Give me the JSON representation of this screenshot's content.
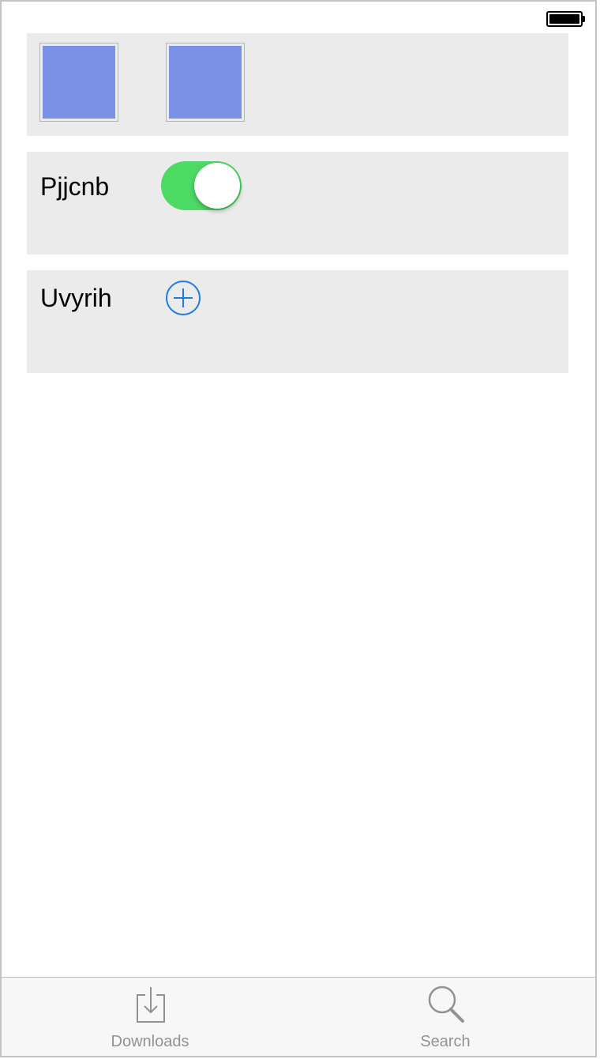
{
  "status_bar": {
    "battery_icon": "battery-full-icon"
  },
  "image_row": {
    "thumbnails": [
      {
        "icon": "image-placeholder",
        "color": "#7a91e6"
      },
      {
        "icon": "image-placeholder",
        "color": "#7a91e6"
      }
    ]
  },
  "toggle_row": {
    "label": "Pjjcnb",
    "on": true,
    "on_color": "#4cd964"
  },
  "add_row": {
    "label": "Uvyrih",
    "icon": "plus-circle-icon",
    "accent": "#1a7ce8"
  },
  "tab_bar": {
    "tabs": [
      {
        "label": "Downloads",
        "icon": "download-icon"
      },
      {
        "label": "Search",
        "icon": "search-icon"
      }
    ]
  }
}
